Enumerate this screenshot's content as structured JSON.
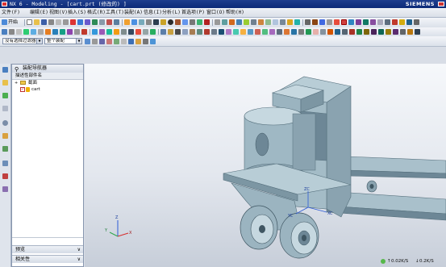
{
  "window": {
    "title": "NX 6 - Modeling - [cart.prt (修改的) ]",
    "brand": "SIEMENS"
  },
  "menu": [
    {
      "label": "文件",
      "key": "(F)"
    },
    {
      "label": "编辑",
      "key": "(E)"
    },
    {
      "label": "视图",
      "key": "(V)"
    },
    {
      "label": "插入",
      "key": "(S)"
    },
    {
      "label": "格式",
      "key": "(R)"
    },
    {
      "label": "工具",
      "key": "(T)"
    },
    {
      "label": "装配",
      "key": "(A)"
    },
    {
      "label": "信息",
      "key": "(I)"
    },
    {
      "label": "分析",
      "key": "(L)"
    },
    {
      "label": "首选项",
      "key": "(P)"
    },
    {
      "label": "窗口",
      "key": "(O)"
    },
    {
      "label": "帮助",
      "key": "(H)"
    }
  ],
  "toolbar": {
    "start_label": "开始",
    "filter_dropdown": "没有选择过滤器",
    "assembly_dropdown": "整个装配"
  },
  "navigator": {
    "title": "装配导航器",
    "column_header": "描述性部件名",
    "items": [
      {
        "label": "截面"
      },
      {
        "label": "cart"
      }
    ],
    "footer_preview": "预览",
    "footer_dependencies": "相关性"
  },
  "triad_labels": {
    "x": "X",
    "y": "Y",
    "z": "Z"
  },
  "csys_labels": {
    "x": "XC",
    "y": "YC",
    "z": "ZC"
  },
  "status": {
    "up_speed": "0.02K/S",
    "down_speed": "0.2K/S"
  },
  "colors": {
    "title_bar": "#0b2a78",
    "part_body": "#9fb8c4",
    "part_dark": "#5f7885",
    "viewport_top": "#f6f8fb",
    "viewport_bottom": "#c7ced9",
    "selected_part": "#e03030"
  }
}
